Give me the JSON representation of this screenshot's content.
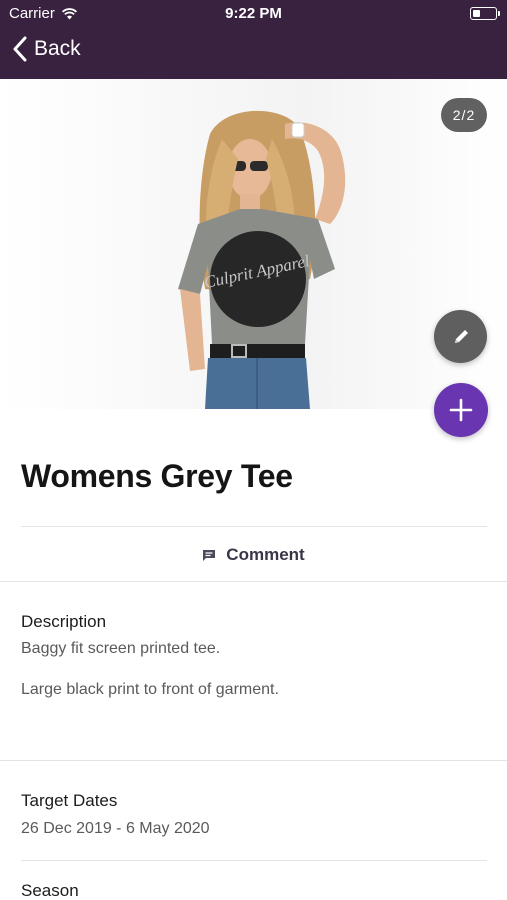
{
  "status_bar": {
    "carrier": "Carrier",
    "time": "9:22 PM",
    "battery_level": 0.35
  },
  "nav": {
    "back_label": "Back"
  },
  "image": {
    "counter": "2/2",
    "shirt_print": "Culprit Apparel"
  },
  "product": {
    "title": "Womens Grey Tee"
  },
  "actions": {
    "comment_label": "Comment"
  },
  "sections": {
    "description": {
      "label": "Description",
      "line1": "Baggy fit screen printed tee.",
      "line2": "Large black print to front of garment."
    },
    "target_dates": {
      "label": "Target Dates",
      "value": "26 Dec 2019 - 6 May 2020"
    },
    "season": {
      "label": "Season"
    }
  },
  "colors": {
    "header_bg": "#38223f",
    "add_fab": "#6a35b0",
    "edit_fab": "#5f5f5f"
  }
}
